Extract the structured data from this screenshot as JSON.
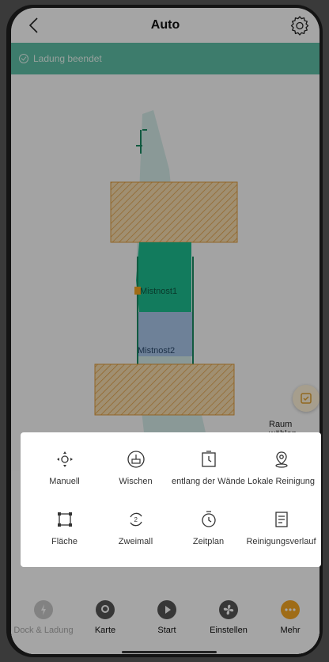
{
  "header": {
    "title": "Auto",
    "back_icon": "chevron-left-icon",
    "settings_icon": "gear-icon"
  },
  "status": {
    "text": "Ladung beendet",
    "icon": "check-circle-icon",
    "color": "#5fbfa6"
  },
  "map": {
    "rooms": [
      {
        "label": "Mistnost1"
      },
      {
        "label": "Mistnost2"
      }
    ],
    "zone_color": "#e8a23a",
    "room_colors": [
      "#1dbd8f",
      "#aac6ea"
    ],
    "room_select": {
      "label": "Raum wählen",
      "icon": "checkbox-icon"
    }
  },
  "menu": {
    "items": [
      {
        "label": "Manuell",
        "icon": "move-arrows-icon"
      },
      {
        "label": "Wischen",
        "icon": "mop-icon"
      },
      {
        "label": "entlang der Wände",
        "icon": "wall-follow-icon"
      },
      {
        "label": "Lokale Reinigung",
        "icon": "location-pin-icon"
      },
      {
        "label": "Fläche",
        "icon": "area-square-icon"
      },
      {
        "label": "Zweimall",
        "icon": "repeat-twice-icon"
      },
      {
        "label": "Zeitplan",
        "icon": "timer-icon"
      },
      {
        "label": "Reinigungsverlauf",
        "icon": "history-document-icon"
      }
    ]
  },
  "tabs": [
    {
      "label": "Dock & Ladung",
      "icon": "charging-dock-icon",
      "color": "#c8c8c8"
    },
    {
      "label": "Karte",
      "icon": "map-pin-icon",
      "color": "#555555"
    },
    {
      "label": "Start",
      "icon": "play-icon",
      "color": "#555555"
    },
    {
      "label": "Einstellen",
      "icon": "fan-icon",
      "color": "#555555"
    },
    {
      "label": "Mehr",
      "icon": "more-dots-icon",
      "color": "#f5a623"
    }
  ]
}
